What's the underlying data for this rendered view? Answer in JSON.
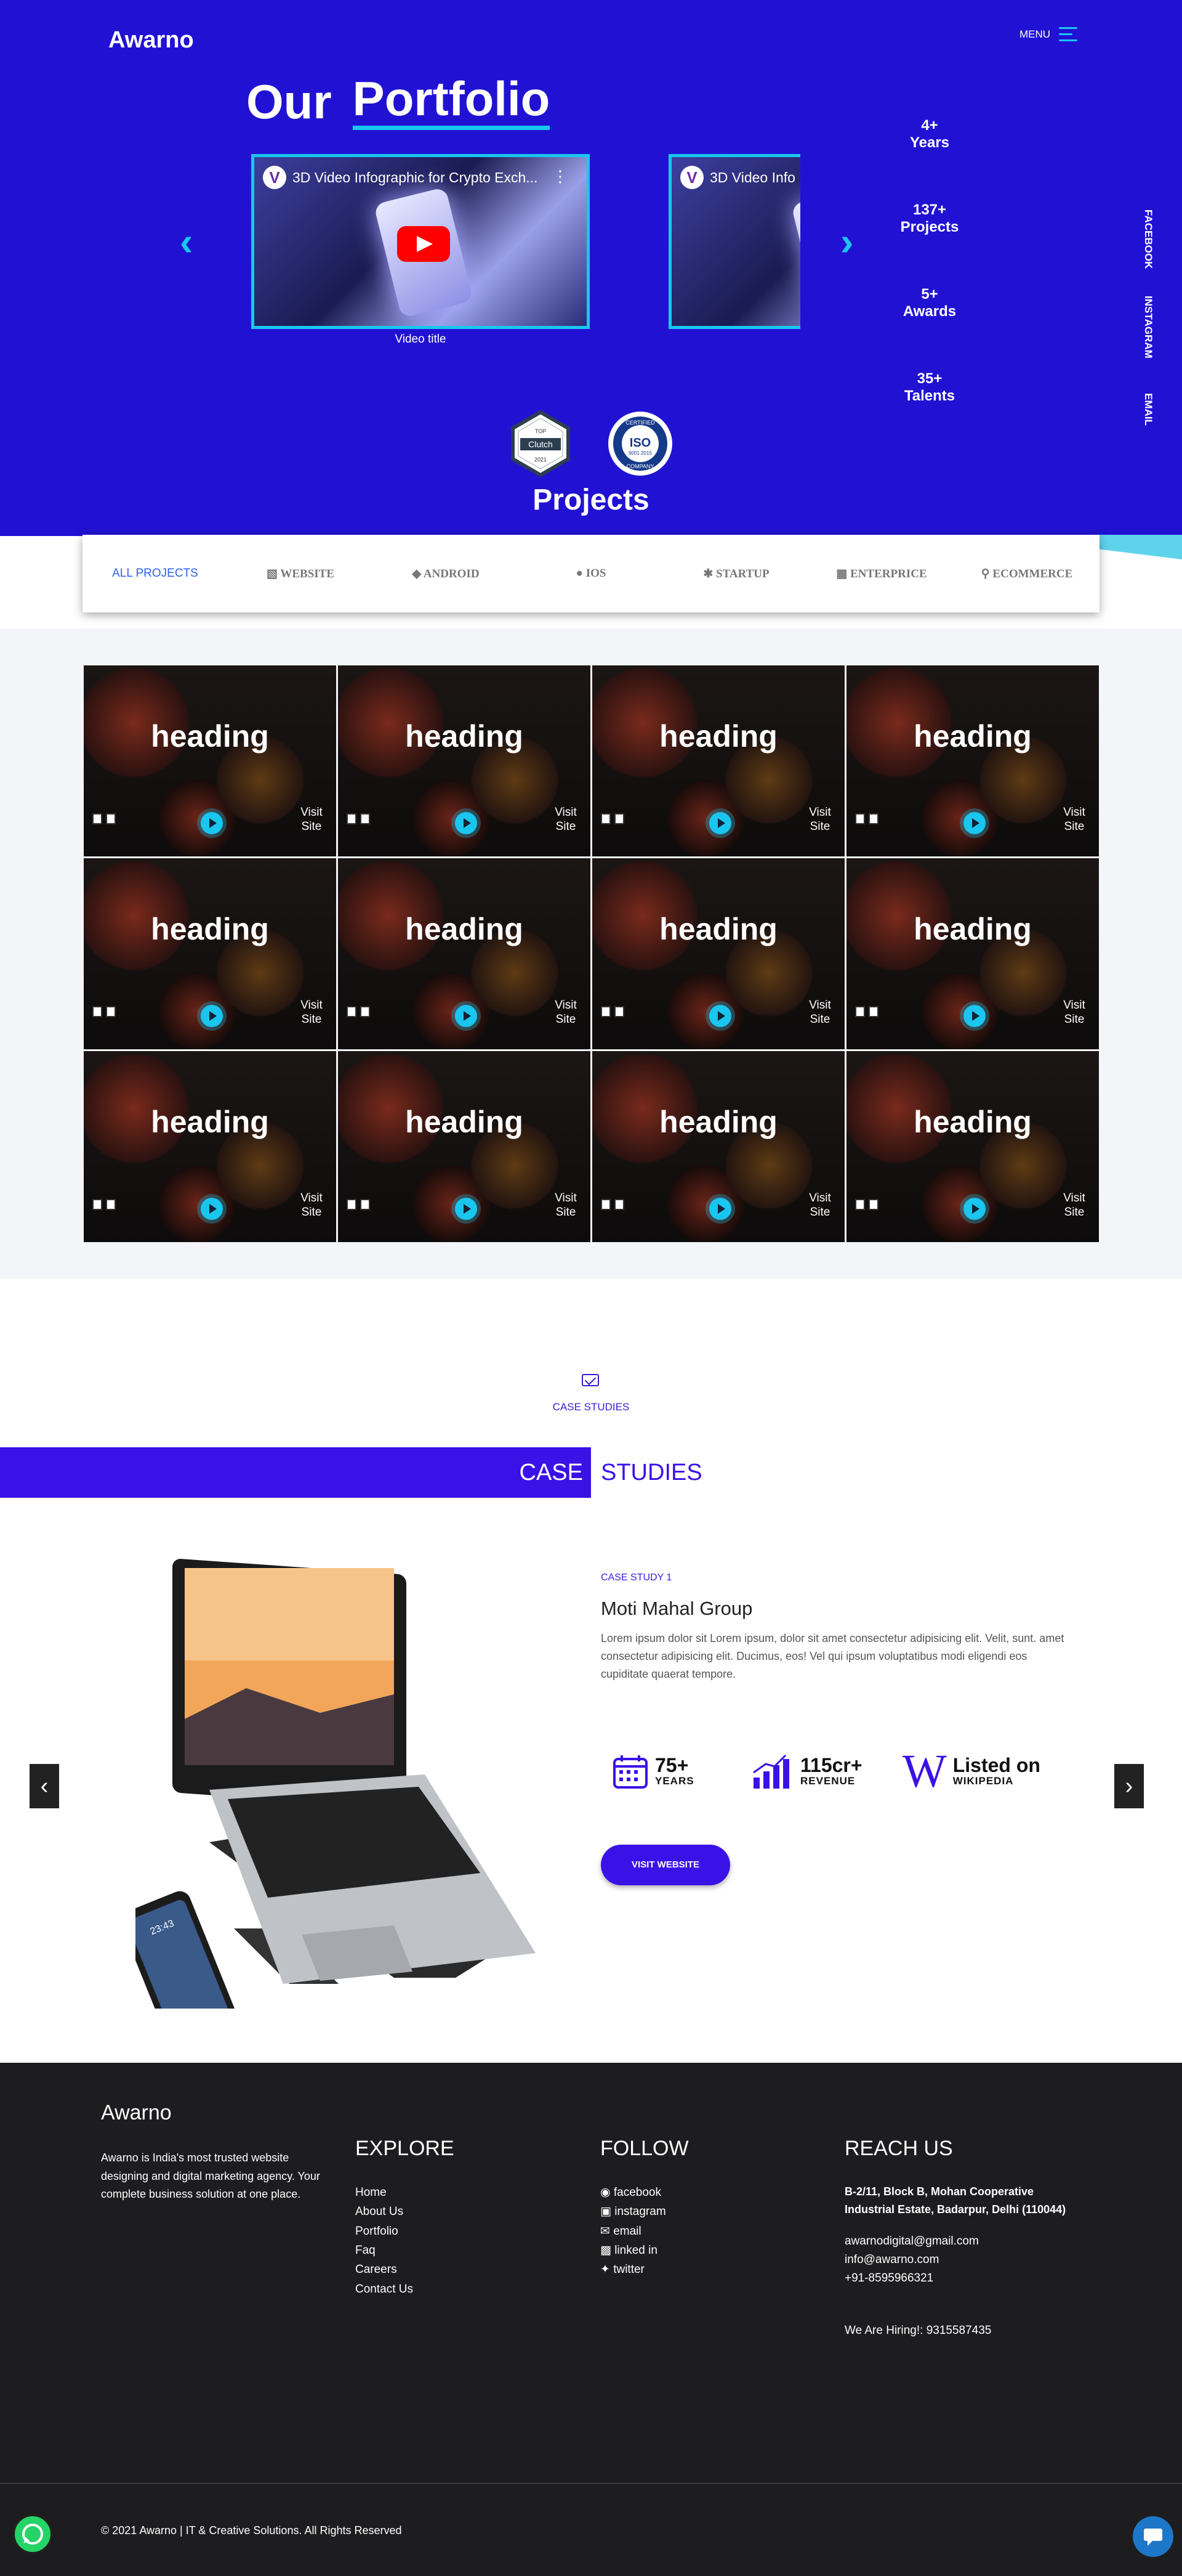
{
  "header": {
    "logo": "Awarno",
    "menu_label": "MENU"
  },
  "hero": {
    "title_word1": "Our",
    "title_word2": "Portfolio",
    "videos": [
      {
        "title": "3D Video Infographic for Crypto Exch...",
        "channel_icon": "V"
      },
      {
        "title": "3D Video Info",
        "channel_icon": "V"
      }
    ],
    "video_caption": "Video title",
    "stats": [
      {
        "value": "4+",
        "label": "Years"
      },
      {
        "value": "137+",
        "label": "Projects"
      },
      {
        "value": "5+",
        "label": "Awards"
      },
      {
        "value": "35+",
        "label": "Talents"
      }
    ],
    "social": [
      "FACEBOOK",
      "INSTAGRAM",
      "EMAIL"
    ],
    "badges": {
      "clutch": {
        "top": "TOP",
        "mid": "Clutch",
        "bottom": "2021"
      },
      "iso": {
        "top": "CERTIFIED",
        "mid": "ISO",
        "sub": "9001:2015",
        "bottom": "COMPANY"
      }
    },
    "projects_heading": "Projects"
  },
  "filters": [
    {
      "label": "ALL PROJECTS",
      "icon": "",
      "active": true
    },
    {
      "label": "WEBSITE",
      "icon": "id-card-icon"
    },
    {
      "label": "ANDROID",
      "icon": "android-icon"
    },
    {
      "label": "IOS",
      "icon": "apple-icon"
    },
    {
      "label": "STARTUP",
      "icon": "running-person-icon"
    },
    {
      "label": "ENTERPRICE",
      "icon": "building-icon"
    },
    {
      "label": "ECOMMERCE",
      "icon": "cart-icon"
    }
  ],
  "project_cards": [
    {
      "heading": "heading",
      "visit": "Visit Site"
    },
    {
      "heading": "heading",
      "visit": "Visit Site"
    },
    {
      "heading": "heading",
      "visit": "Visit Site"
    },
    {
      "heading": "heading",
      "visit": "Visit Site"
    },
    {
      "heading": "heading",
      "visit": "Visit Site"
    },
    {
      "heading": "heading",
      "visit": "Visit Site"
    },
    {
      "heading": "heading",
      "visit": "Visit Site"
    },
    {
      "heading": "heading",
      "visit": "Visit Site"
    },
    {
      "heading": "heading",
      "visit": "Visit Site"
    },
    {
      "heading": "heading",
      "visit": "Visit Site"
    },
    {
      "heading": "heading",
      "visit": "Visit Site"
    },
    {
      "heading": "heading",
      "visit": "Visit Site"
    }
  ],
  "case_studies": {
    "label": "CASE STUDIES",
    "band_word1": "CASE",
    "band_word2": "STUDIES",
    "number": "CASE STUDY 1",
    "name": "Moti Mahal Group",
    "description": "Lorem ipsum dolor sit Lorem ipsum, dolor sit amet consectetur adipisicing elit. Velit, sunt. amet consectetur adipisicing elit. Ducimus, eos! Vel qui ipsum voluptatibus modi eligendi eos cupiditate quaerat tempore.",
    "metrics": [
      {
        "value": "75+",
        "label": "YEARS",
        "icon": "calendar-icon"
      },
      {
        "value": "115cr+",
        "label": "REVENUE",
        "icon": "growth-chart-icon"
      },
      {
        "value": "Listed on",
        "label": "WIKIPEDIA",
        "icon": "wikipedia-icon",
        "icon_letter": "W"
      }
    ],
    "button": "VISIT WEBSITE",
    "phone_time": "23:43"
  },
  "footer": {
    "logo": "Awarno",
    "about": "Awarno is India's most trusted website designing and digital marketing agency. Your complete business solution at one place.",
    "explore": {
      "heading": "EXPLORE",
      "links": [
        "Home",
        "About Us",
        "Portfolio",
        "Faq",
        "Careers",
        "Contact Us"
      ]
    },
    "follow": {
      "heading": "FOLLOW",
      "links": [
        "facebook",
        "instagram",
        "email",
        "linked in",
        "twitter"
      ]
    },
    "reach": {
      "heading": "REACH US",
      "address": "B-2/11, Block B, Mohan Cooperative Industrial Estate, Badarpur, Delhi (110044)",
      "email1": "awarnodigital@gmail.com",
      "email2": "info@awarno.com",
      "phone": "+91-8595966321",
      "hiring": "We Are Hiring!: 9315587435"
    },
    "copyright": "© 2021 Awarno | IT & Creative Solutions. All Rights Reserved"
  },
  "colors": {
    "brand": "#2112d3",
    "accent": "#19c6f0",
    "case_band": "#3a12e8",
    "footer": "#1d1d1f"
  }
}
